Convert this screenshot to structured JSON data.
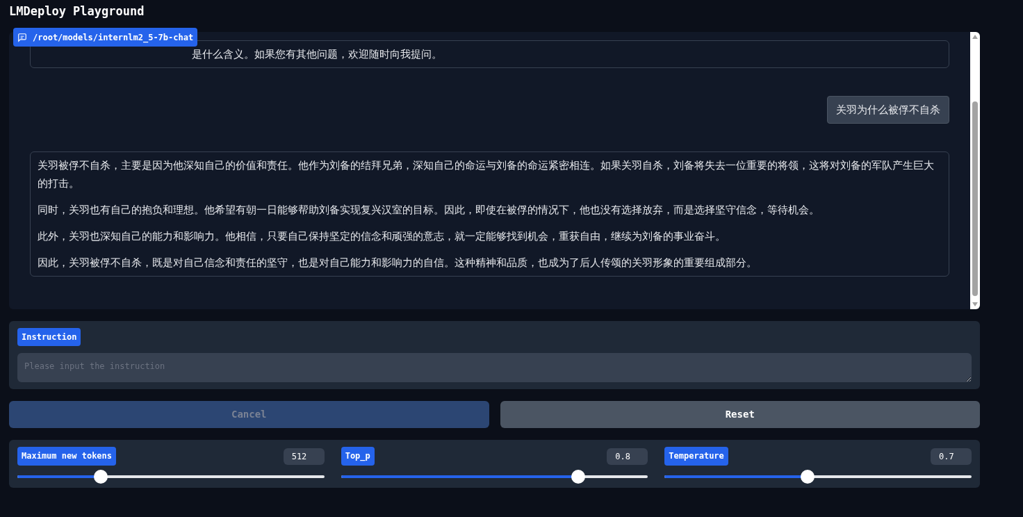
{
  "title": "LMDeploy Playground",
  "chat": {
    "model_label": "/root/models/internlm2_5-7b-chat",
    "messages": [
      {
        "kind": "bot_cut",
        "paragraphs": [
          "是什么含义。如果您有其他问题，欢迎随时向我提问。"
        ]
      },
      {
        "kind": "user",
        "paragraphs": [
          "关羽为什么被俘不自杀"
        ]
      },
      {
        "kind": "bot",
        "paragraphs": [
          "关羽被俘不自杀，主要是因为他深知自己的价值和责任。他作为刘备的结拜兄弟，深知自己的命运与刘备的命运紧密相连。如果关羽自杀，刘备将失去一位重要的将领，这将对刘备的军队产生巨大的打击。",
          "同时，关羽也有自己的抱负和理想。他希望有朝一日能够帮助刘备实现复兴汉室的目标。因此，即使在被俘的情况下，他也没有选择放弃，而是选择坚守信念，等待机会。",
          "此外，关羽也深知自己的能力和影响力。他相信，只要自己保持坚定的信念和顽强的意志，就一定能够找到机会，重获自由，继续为刘备的事业奋斗。",
          "因此，关羽被俘不自杀，既是对自己信念和责任的坚守，也是对自己能力和影响力的自信。这种精神和品质，也成为了后人传颂的关羽形象的重要组成部分。"
        ]
      }
    ]
  },
  "instruction": {
    "label": "Instruction",
    "placeholder": "Please input the instruction"
  },
  "buttons": [
    {
      "label": "Cancel",
      "disabled": true
    },
    {
      "label": "Reset",
      "disabled": false
    }
  ],
  "sliders": [
    {
      "label": "Maximum new tokens",
      "reading": "512",
      "level": 0.26
    },
    {
      "label": "Top_p",
      "reading": "0.8",
      "level": 0.785
    },
    {
      "label": "Temperature",
      "reading": "0.7",
      "level": 0.465
    }
  ]
}
